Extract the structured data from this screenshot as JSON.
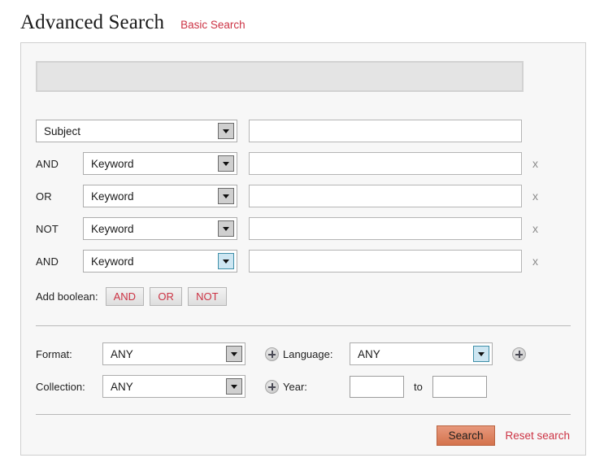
{
  "header": {
    "title": "Advanced Search",
    "basic_search_link": "Basic Search"
  },
  "notice": {
    "text": ""
  },
  "search_rows": [
    {
      "boolean": "",
      "field_value": "Subject",
      "term_value": "",
      "remove_label": "",
      "arrow_focused": false
    },
    {
      "boolean": "AND",
      "field_value": "Keyword",
      "term_value": "",
      "remove_label": "x",
      "arrow_focused": false
    },
    {
      "boolean": "OR",
      "field_value": "Keyword",
      "term_value": "",
      "remove_label": "x",
      "arrow_focused": false
    },
    {
      "boolean": "NOT",
      "field_value": "Keyword",
      "term_value": "",
      "remove_label": "x",
      "arrow_focused": false
    },
    {
      "boolean": "AND",
      "field_value": "Keyword",
      "term_value": "",
      "remove_label": "x",
      "arrow_focused": true
    }
  ],
  "add_boolean": {
    "label": "Add boolean:",
    "buttons": [
      "AND",
      "OR",
      "NOT"
    ]
  },
  "facets": {
    "format": {
      "label": "Format:",
      "value": "ANY",
      "add_icon": "plus-icon"
    },
    "collection": {
      "label": "Collection:",
      "value": "ANY",
      "add_icon": "plus-icon"
    },
    "language": {
      "label": "Language:",
      "value": "ANY",
      "add_icon": "plus-icon"
    },
    "year": {
      "label": "Year:",
      "from_value": "",
      "to_label": "to",
      "to_value": ""
    }
  },
  "footer": {
    "search_label": "Search",
    "reset_label": "Reset search"
  },
  "colors": {
    "accent_red": "#cc3344",
    "search_button": "#d4734d",
    "panel_bg": "#f7f7f7",
    "focus_blue": "#cde6f2"
  }
}
